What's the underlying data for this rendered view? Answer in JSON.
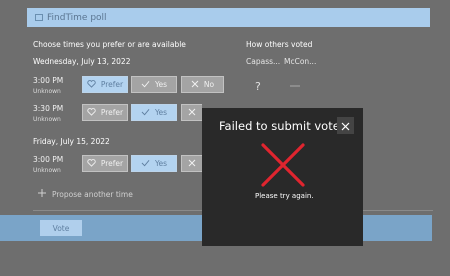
{
  "poll": {
    "title": "FindTime poll",
    "choose_header": "Choose times you prefer or are available",
    "others_header": "How others voted",
    "others": [
      "Capass...",
      "McCon..."
    ],
    "unknown_vote": "?",
    "options": {
      "prefer": "Prefer",
      "yes": "Yes",
      "no": "No"
    },
    "dates": [
      {
        "label": "Wednesday, July 13, 2022",
        "slots": [
          {
            "time": "3:00 PM",
            "status": "Unknown",
            "selected": "prefer"
          },
          {
            "time": "3:30 PM",
            "status": "Unknown",
            "selected": "yes"
          }
        ]
      },
      {
        "label": "Friday, July 15, 2022",
        "slots": [
          {
            "time": "3:00 PM",
            "status": "Unknown",
            "selected": "yes"
          }
        ]
      }
    ],
    "propose_label": "Propose another time",
    "vote_label": "Vote"
  },
  "dialog": {
    "title": "Failed to submit votes.",
    "message": "Please try again.",
    "error_icon": "red-x-icon",
    "close_icon": "close-icon",
    "error_color": "#e0252f"
  },
  "colors": {
    "overlay": "#6e6e6e",
    "accent": "#b3d3f0",
    "dialog_bg": "#292929"
  }
}
